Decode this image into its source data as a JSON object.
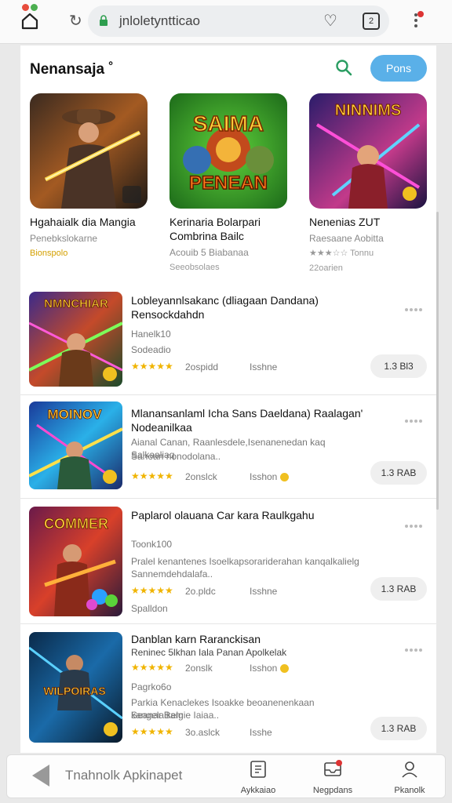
{
  "browser": {
    "url": "jnloletyntticao",
    "tab_count": "2"
  },
  "header": {
    "title": "Nenansaja ˚",
    "button_label": "Pons"
  },
  "featured": [
    {
      "name": "Hgahaialk dia Mangia",
      "sub": "Penebkslokarne",
      "meta1": "Bionspolo",
      "meta2": "",
      "thumb": "cowboy-gunner",
      "badge": "5"
    },
    {
      "name": "Kerinaria Bolarpari Combrina Bailc",
      "sub": "Acouib 5 Biabanaa",
      "meta1": "Seeobsolaes",
      "meta2": "",
      "thumb": "saima-penean",
      "badge": "SAIMA PENEAN"
    },
    {
      "name": "Nenenias ZUT",
      "sub": "Raesaane Aobitta",
      "meta1": "★★★☆☆  Tonnu",
      "meta2": "22oarien",
      "thumb": "ninja-warrior",
      "badge": "NINNIMS"
    }
  ],
  "apps": [
    {
      "title": "Lobleyannlsakanc (dliagaan Dandana) Rensockdahdn",
      "line1": "Hanelk10",
      "line2": "Sodeadio",
      "line3": "",
      "stars": "★★★★★",
      "rating_count": "2ospidd",
      "section": "Isshne",
      "price": "1.3 Bl3",
      "thumb": "NMNCHIAR"
    },
    {
      "title": "Mlanansanlaml Icha Sans Daeldana) Raalagan' Nodeanilkaa",
      "line1": "Aianal Canan, Raanlesdele,Isenanenedan kaq Salkaaliaq",
      "line2": "Sanoan nonodolana..",
      "line3": "",
      "stars": "★★★★★",
      "rating_count": "2onslck",
      "section": "Isshon",
      "price": "1.3 RAB",
      "thumb": "MOINOV"
    },
    {
      "title": "Paplarol olauana Car kara Raulkgahu",
      "line1": "Toonk100",
      "line2": "Pralel kenantenes Isoelkapsorariderahan kanqalkalielg",
      "line3": "Sannemdehdalafa..",
      "stars": "★★★★★",
      "rating_count": "2o.pldc",
      "section": "Isshne",
      "price": "1.3 RAB",
      "extra": "Spalldon",
      "thumb": "COMMER"
    },
    {
      "title": "Danblan karn Raranckisan",
      "line1": "Reninec 5lkhan Iala Panan Apolkelak",
      "line2": "Pagrko6o",
      "line3": "Parkia Kenaclekes Isoakke beoanenenkaan kangelalkelg",
      "line4": "Seanar Bamie Iaiaa..",
      "stars": "★★★★★",
      "rating_count": "2onslk",
      "section": "Isshon",
      "stars2": "★★★★★",
      "rating_count2": "3o.aslck",
      "section2": "Isshe",
      "price": "1.3 RAB",
      "thumb": "WILPOIRAS"
    }
  ],
  "bottom_nav": {
    "back_label": "Tnahnolk Apkinapet",
    "items": [
      {
        "label": "Aykkaiao",
        "icon": "list-icon"
      },
      {
        "label": "Negpdans",
        "icon": "inbox-icon"
      },
      {
        "label": "Pkanolk",
        "icon": "profile-icon"
      }
    ]
  },
  "colors": {
    "accent": "#5ab0e8",
    "star": "#f0b400",
    "lock": "#2e9e4f"
  }
}
